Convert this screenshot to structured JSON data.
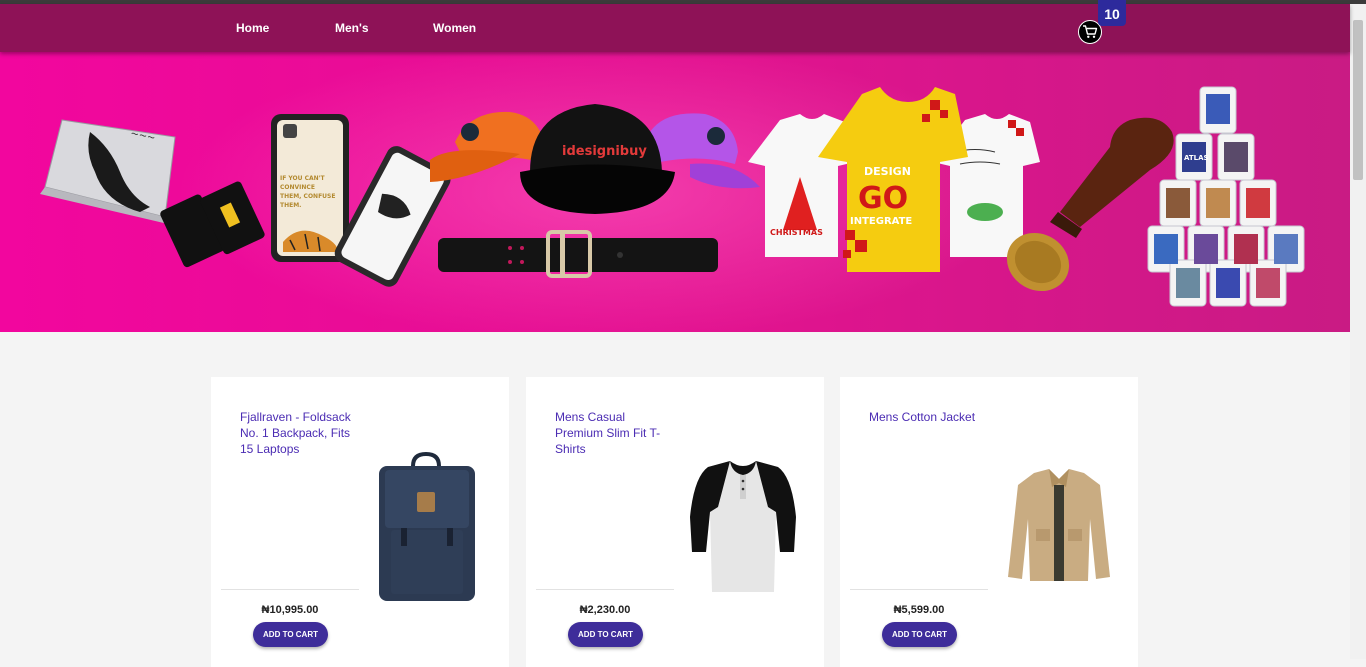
{
  "nav": {
    "links": [
      "Home",
      "Men's",
      "Women"
    ],
    "cart_count": "10"
  },
  "hero": {
    "cap_brand": "idesignibuy",
    "phone_text": "IF YOU CAN'T CONVINCE THEM, CONFUSE THEM.",
    "tshirt_left_text": "CHRISTMAS",
    "tshirt_center_line1": "DESIGN",
    "tshirt_center_line2": "GO",
    "tshirt_center_line3": "INTEGRATE",
    "mug_text": "ATLAS"
  },
  "products": [
    {
      "title": "Fjallraven - Foldsack No. 1 Backpack, Fits 15 Laptops",
      "price": "₦10,995.00",
      "button": "ADD TO CART"
    },
    {
      "title": "Mens Casual Premium Slim Fit T-Shirts",
      "price": "₦2,230.00",
      "button": "ADD TO CART"
    },
    {
      "title": "Mens Cotton Jacket",
      "price": "₦5,599.00",
      "button": "ADD TO CART"
    }
  ],
  "colors": {
    "navbar": "#8e1257",
    "hero": "#e1138f",
    "accent": "#3e2d9a",
    "title_link": "#4b2cb3"
  }
}
